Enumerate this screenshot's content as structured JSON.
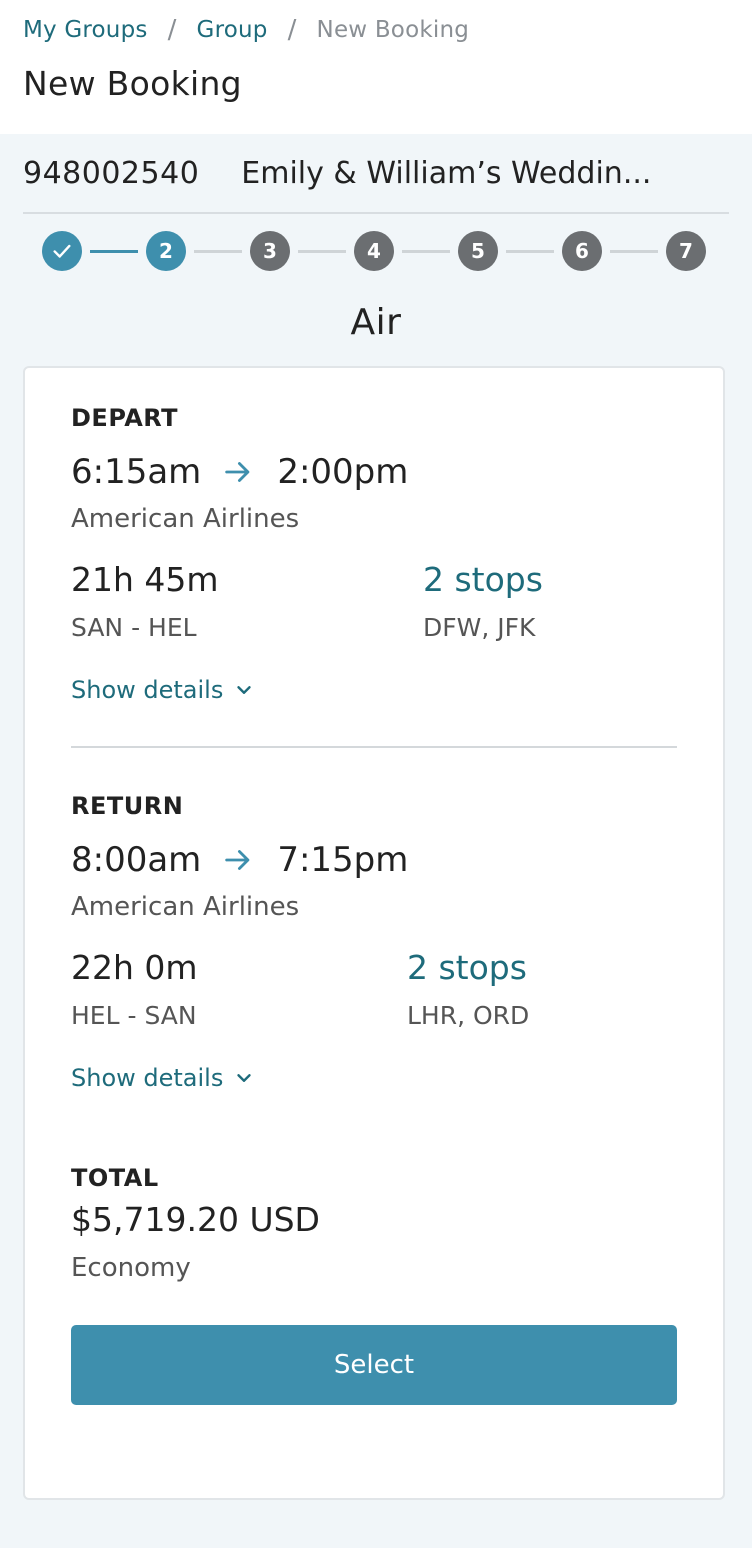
{
  "breadcrumb": {
    "items": [
      "My Groups",
      "Group"
    ],
    "separator": "/",
    "current": "New Booking"
  },
  "page_title": "New Booking",
  "group": {
    "id": "948002540",
    "name": "Emily & William’s Weddin..."
  },
  "stepper": {
    "steps": [
      "2",
      "3",
      "4",
      "5",
      "6",
      "7"
    ],
    "completed_icon": "check-icon",
    "current_step": 2,
    "active_color": "#3e8fad",
    "inactive_color": "#6b6e71"
  },
  "section_title": "Air",
  "depart": {
    "label": "DEPART",
    "depart_time": "6:15am",
    "arrive_time": "2:00pm",
    "airline": "American Airlines",
    "duration": "21h 45m",
    "route": "SAN - HEL",
    "stops": "2 stops",
    "stop_codes": "DFW, JFK",
    "show_details": "Show details"
  },
  "return": {
    "label": "RETURN",
    "depart_time": "8:00am",
    "arrive_time": "7:15pm",
    "airline": "American Airlines",
    "duration": "22h 0m",
    "route": "HEL - SAN",
    "stops": "2 stops",
    "stop_codes": "LHR, ORD",
    "show_details": "Show details"
  },
  "total": {
    "label": "TOTAL",
    "amount": "$5,719.20 USD",
    "fare_class": "Economy"
  },
  "select_label": "Select",
  "colors": {
    "link": "#1e6b7b",
    "accent": "#3e8fad",
    "background": "#f1f6f9"
  }
}
